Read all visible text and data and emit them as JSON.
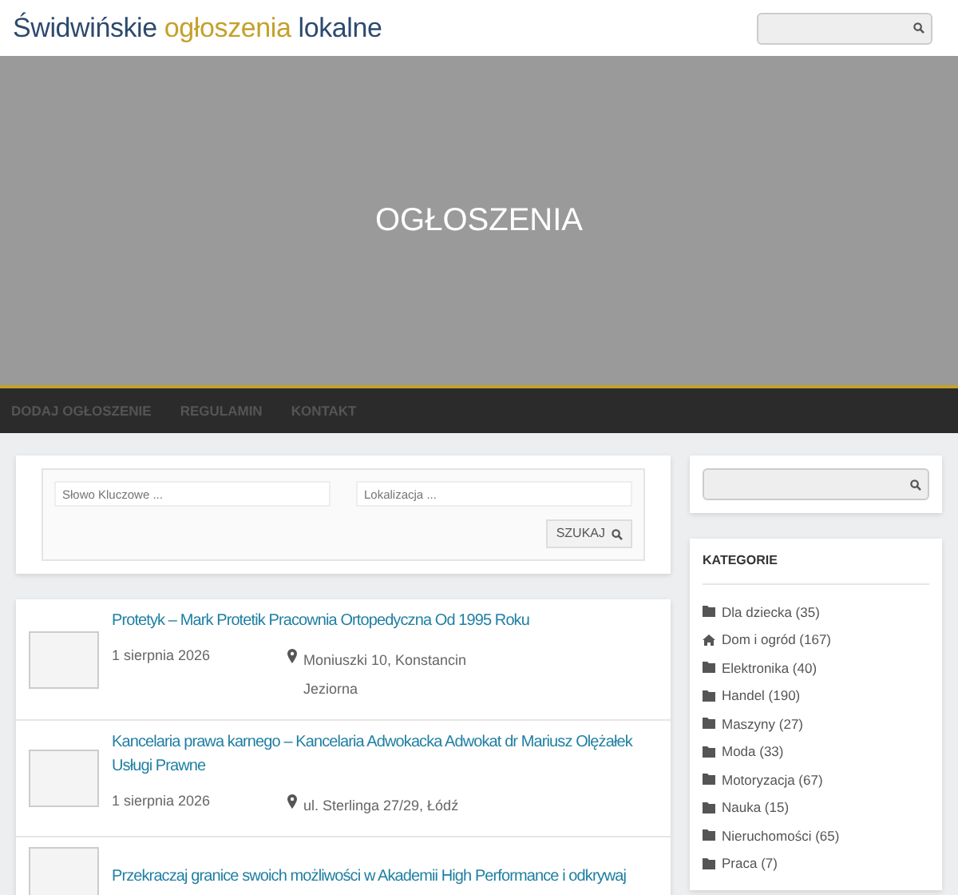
{
  "site_title": [
    {
      "text": "Świdwińskie",
      "accent": false
    },
    {
      "text": "ogłoszenia",
      "accent": true
    },
    {
      "text": "lokalne",
      "accent": false
    }
  ],
  "hero": {
    "title": "OGŁOSZENIA"
  },
  "nav": [
    "DODAJ OGŁOSZENIE",
    "REGULAMIN",
    "KONTAKT"
  ],
  "search_form": {
    "keyword_placeholder": "Słowo Kluczowe ...",
    "location_placeholder": "Lokalizacja ...",
    "button": "SZUKAJ"
  },
  "listings": [
    {
      "title": "Protetyk – Mark Protetik Pracownia Ortopedyczna Od 1995 Roku",
      "date": "1 sierpnia 2026",
      "location": "Moniuszki 10, Konstancin Jeziorna"
    },
    {
      "title": "Kancelaria prawa karnego – Kancelaria Adwokacka Adwokat dr Mariusz Olężałek Usługi Prawne",
      "date": "1 sierpnia 2026",
      "location": "ul. Sterlinga 27/29, Łódź"
    },
    {
      "title": "Przekraczaj granice swoich możliwości w Akademii High Performance i odkrywaj"
    }
  ],
  "sidebar": {
    "categories_heading": "KATEGORIE",
    "categories": [
      {
        "label": "Dla dziecka (35)",
        "kind": "folder"
      },
      {
        "label": "Dom i ogród (167)",
        "kind": "home"
      },
      {
        "label": "Elektronika (40)",
        "kind": "folder"
      },
      {
        "label": "Handel (190)",
        "kind": "folder"
      },
      {
        "label": "Maszyny (27)",
        "kind": "folder"
      },
      {
        "label": "Moda (33)",
        "kind": "folder"
      },
      {
        "label": "Motoryzacja (67)",
        "kind": "folder"
      },
      {
        "label": "Nauka (15)",
        "kind": "folder"
      },
      {
        "label": "Nieruchomości (65)",
        "kind": "folder"
      },
      {
        "label": "Praca (7)",
        "kind": "folder"
      }
    ]
  }
}
